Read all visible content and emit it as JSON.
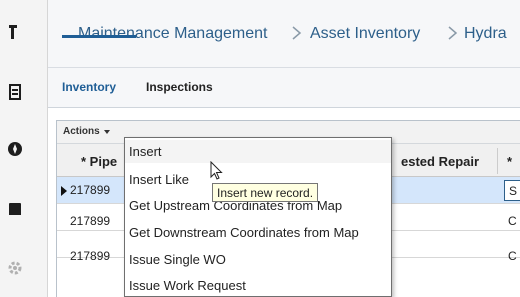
{
  "nav_rail": {
    "icons": [
      "tools-icon",
      "document-list-icon",
      "compass-icon",
      "folder-icon",
      "gear-icon"
    ]
  },
  "breadcrumb": {
    "items": [
      "Maintenance Management",
      "Asset Inventory",
      "Hydra"
    ]
  },
  "tabs": [
    {
      "label": "Inventory",
      "active": true
    },
    {
      "label": "Inspections",
      "active": false
    }
  ],
  "toolbar": {
    "actions_label": "Actions"
  },
  "grid": {
    "columns": [
      "* Pipe",
      "ested Repair",
      "*"
    ],
    "rows": [
      {
        "pipe": "217899",
        "last": "S",
        "selected": true
      },
      {
        "pipe": "217899",
        "last": "C",
        "selected": false
      },
      {
        "pipe": "217899",
        "last": "C",
        "selected": false
      }
    ]
  },
  "context_menu": {
    "items": [
      "Insert",
      "Insert Like",
      "Get Upstream Coordinates from Map",
      "Get Downstream Coordinates from Map",
      "Issue Single WO",
      "Issue Work Request"
    ],
    "hovered_index": 0
  },
  "tooltip": {
    "text": "Insert new record."
  },
  "colors": {
    "link_blue": "#2d5f8a",
    "tab_active": "#1f5e96",
    "row_selected": "#d4e6fb",
    "tooltip_bg": "#ffffe1"
  }
}
